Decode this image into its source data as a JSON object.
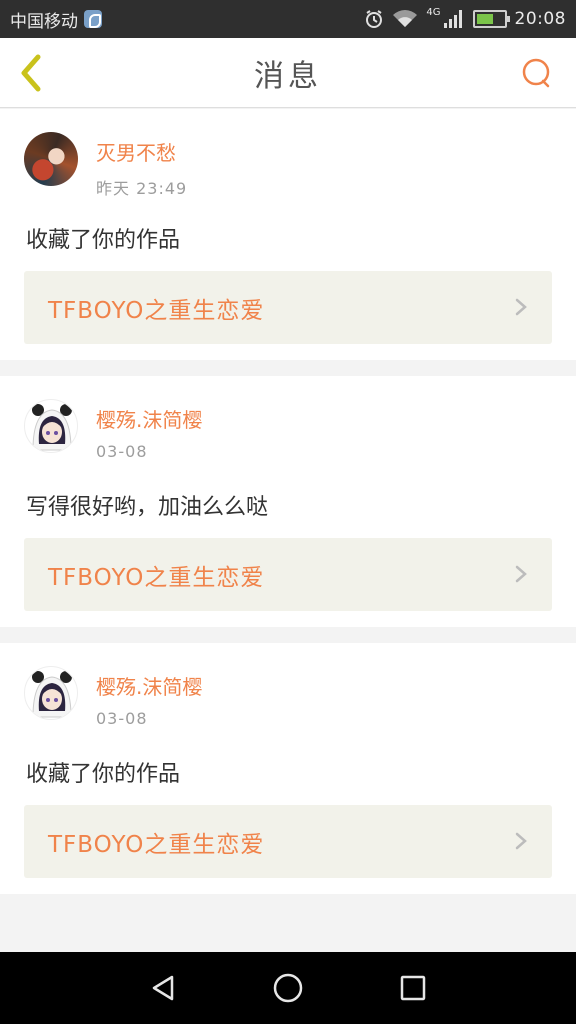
{
  "status_bar": {
    "carrier": "中国移动",
    "network": "4G",
    "time": "20:08",
    "battery_level": 0.55,
    "icons": [
      "app-s-icon",
      "alarm-icon",
      "wifi-icon",
      "signal-icon",
      "battery-charging-icon"
    ]
  },
  "header": {
    "title": "消息",
    "back_icon": "chevron-left-icon",
    "search_icon": "search-icon"
  },
  "colors": {
    "accent": "#f0834a",
    "back_chevron": "#c9c21c",
    "card_link_bg": "#f2f2ea",
    "page_bg": "#f3f3f3"
  },
  "messages": [
    {
      "username": "灭男不愁",
      "timestamp": "昨天 23:49",
      "text": "收藏了你的作品",
      "work_title": "TFBOYO之重生恋爱",
      "avatar": "photo"
    },
    {
      "username": "樱殇.沫简樱",
      "timestamp": "03-08",
      "text": "写得很好哟，加油么么哒",
      "work_title": "TFBOYO之重生恋爱",
      "avatar": "anime-girl"
    },
    {
      "username": "樱殇.沫简樱",
      "timestamp": "03-08",
      "text": "收藏了你的作品",
      "work_title": "TFBOYO之重生恋爱",
      "avatar": "anime-girl"
    }
  ],
  "nav_bar": {
    "icons": [
      "back-triangle-icon",
      "home-circle-icon",
      "recents-square-icon"
    ]
  }
}
